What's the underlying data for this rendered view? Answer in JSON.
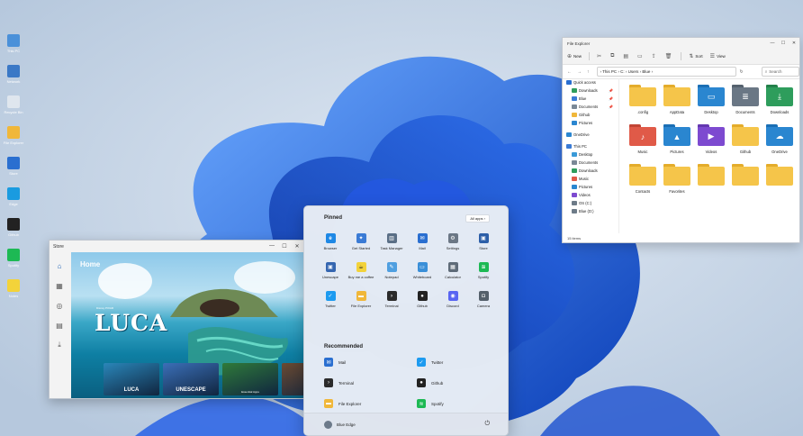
{
  "colors": {
    "accent": "#1b62d6",
    "folder": "#f5c54a",
    "folder_tab": "#e4ac2b"
  },
  "desktop": {
    "icons": [
      {
        "name": "this-pc-icon",
        "color": "#4a90d9",
        "label": "This PC"
      },
      {
        "name": "network-icon",
        "color": "#3a78c6",
        "label": "Network"
      },
      {
        "name": "recycle-bin-icon",
        "color": "#dfe6ee",
        "label": "Recycle Bin"
      },
      {
        "name": "file-explorer-icon",
        "color": "#f0b73a",
        "label": "File Explorer"
      },
      {
        "name": "store-icon",
        "color": "#2a6fd0",
        "label": "Store"
      },
      {
        "name": "edge-icon",
        "color": "#1a9be0",
        "label": "Edge"
      },
      {
        "name": "github-icon",
        "color": "#222222",
        "label": "Github"
      },
      {
        "name": "spotify-icon",
        "color": "#1db954",
        "label": "Spotify"
      },
      {
        "name": "notes-icon",
        "color": "#f3d33a",
        "label": "Notes"
      }
    ]
  },
  "store": {
    "title": "Store",
    "controls": [
      "—",
      "☐",
      "✕"
    ],
    "nav": [
      {
        "name": "home-icon",
        "glyph": "⌂",
        "active": true
      },
      {
        "name": "apps-icon",
        "glyph": "▦",
        "active": false
      },
      {
        "name": "gaming-icon",
        "glyph": "◎",
        "active": false
      },
      {
        "name": "movies-icon",
        "glyph": "▤",
        "active": false
      },
      {
        "name": "download-icon",
        "glyph": "⤓",
        "active": false
      }
    ],
    "hero": {
      "heading": "Home",
      "subtitle": "Disney PIXAR",
      "title": "LUCA"
    },
    "tiles": [
      {
        "label": "LUCA",
        "caption": "",
        "color": "#2a86b9"
      },
      {
        "label": "UNESCAPE",
        "caption": "",
        "color": "#3b6fb8"
      },
      {
        "label": "",
        "caption": "Essential Apps",
        "color": "#2f7a3a"
      },
      {
        "label": "",
        "caption": "",
        "color": "#6b4a32"
      }
    ]
  },
  "start": {
    "pinned_label": "Pinned",
    "all_apps_label": "All apps  ›",
    "pinned": [
      {
        "name": "Browser",
        "color": "#1e88e5",
        "glyph": "e"
      },
      {
        "name": "Get Started",
        "color": "#3a7bd5",
        "glyph": "✦"
      },
      {
        "name": "Task Manager",
        "color": "#5a6f86",
        "glyph": "▥"
      },
      {
        "name": "Mail",
        "color": "#2a6fd0",
        "glyph": "✉"
      },
      {
        "name": "Settings",
        "color": "#6b7785",
        "glyph": "⚙"
      },
      {
        "name": "Store",
        "color": "#2d5fa8",
        "glyph": "▣"
      },
      {
        "name": "Unescape",
        "color": "#3566b0",
        "glyph": "▣"
      },
      {
        "name": "Buy me a coffee",
        "color": "#f2d23a",
        "glyph": "☕"
      },
      {
        "name": "Notepad",
        "color": "#4f9fe0",
        "glyph": "✎"
      },
      {
        "name": "Whiteboard",
        "color": "#3a8fd8",
        "glyph": "▭"
      },
      {
        "name": "Calculator",
        "color": "#5e6b78",
        "glyph": "▦"
      },
      {
        "name": "Spotify",
        "color": "#1db954",
        "glyph": "≋"
      },
      {
        "name": "Twitter",
        "color": "#1d9bf0",
        "glyph": "✓"
      },
      {
        "name": "File Explorer",
        "color": "#f0b73a",
        "glyph": "▬"
      },
      {
        "name": "Terminal",
        "color": "#2b2b2b",
        "glyph": "›"
      },
      {
        "name": "Github",
        "color": "#222222",
        "glyph": "●"
      },
      {
        "name": "Discord",
        "color": "#5865f2",
        "glyph": "◉"
      },
      {
        "name": "Camera",
        "color": "#55606b",
        "glyph": "◘"
      }
    ],
    "recommended_label": "Recommended",
    "recommended": [
      {
        "name": "Mail",
        "color": "#2a6fd0",
        "glyph": "✉"
      },
      {
        "name": "Twitter",
        "color": "#1d9bf0",
        "glyph": "✓"
      },
      {
        "name": "Terminal",
        "color": "#2b2b2b",
        "glyph": "›"
      },
      {
        "name": "Github",
        "color": "#222222",
        "glyph": "●"
      },
      {
        "name": "File Explorer",
        "color": "#f0b73a",
        "glyph": "▬"
      },
      {
        "name": "Spotify",
        "color": "#1db954",
        "glyph": "≋"
      }
    ],
    "user": "Blue Edge",
    "power_glyph": "⏻"
  },
  "explorer": {
    "title": "File Explorer",
    "controls": [
      "—",
      "☐",
      "✕"
    ],
    "cmd": {
      "new": "New",
      "sort": "Sort",
      "view": "View"
    },
    "nav_glyphs": [
      "←",
      "→",
      "↑",
      "↻"
    ],
    "path": "› This PC  ›  C:  ›  Users  ›  Blue  ›",
    "search_placeholder": "Search",
    "tree": [
      {
        "label": "Quick access",
        "color": "#2a6fd0",
        "indent": 0,
        "pin": false
      },
      {
        "label": "Downloads",
        "color": "#2e9d5c",
        "indent": 1,
        "pin": true
      },
      {
        "label": "Blue",
        "color": "#3a7bd5",
        "indent": 1,
        "pin": true
      },
      {
        "label": "Documents",
        "color": "#7a8896",
        "indent": 1,
        "pin": true
      },
      {
        "label": "Github",
        "color": "#f0b73a",
        "indent": 1,
        "pin": false
      },
      {
        "label": "Pictures",
        "color": "#2a86d0",
        "indent": 1,
        "pin": false
      },
      {
        "label": "OneDrive",
        "color": "#2a86d0",
        "indent": 0,
        "pin": false
      },
      {
        "label": "This PC",
        "color": "#3a7bd5",
        "indent": 0,
        "pin": false
      },
      {
        "label": "Desktop",
        "color": "#3a9ad8",
        "indent": 1,
        "pin": false
      },
      {
        "label": "Documents",
        "color": "#7a8896",
        "indent": 1,
        "pin": false
      },
      {
        "label": "Downloads",
        "color": "#2e9d5c",
        "indent": 1,
        "pin": false
      },
      {
        "label": "Music",
        "color": "#e05a48",
        "indent": 1,
        "pin": false
      },
      {
        "label": "Pictures",
        "color": "#2a86d0",
        "indent": 1,
        "pin": false
      },
      {
        "label": "Videos",
        "color": "#7d4ad0",
        "indent": 1,
        "pin": false
      },
      {
        "label": "OS (C:)",
        "color": "#6d7b88",
        "indent": 1,
        "pin": false
      },
      {
        "label": "Blue (D:)",
        "color": "#6d7b88",
        "indent": 1,
        "pin": false
      }
    ],
    "items": [
      {
        "label": ".config",
        "color": "#f5c54a",
        "tab": "#e4ac2b",
        "glyph": ""
      },
      {
        "label": "AppData",
        "color": "#f5c54a",
        "tab": "#e4ac2b",
        "glyph": ""
      },
      {
        "label": "Desktop",
        "color": "#2a86d0",
        "tab": "#1b6fb5",
        "glyph": "▭"
      },
      {
        "label": "Documents",
        "color": "#6a7785",
        "tab": "#55616e",
        "glyph": "≣"
      },
      {
        "label": "Downloads",
        "color": "#2e9d5c",
        "tab": "#23804a",
        "glyph": "⤓"
      },
      {
        "label": "Music",
        "color": "#e05a48",
        "tab": "#c24535",
        "glyph": "♪"
      },
      {
        "label": "Pictures",
        "color": "#2a86d0",
        "tab": "#1b6fb5",
        "glyph": "▲"
      },
      {
        "label": "Videos",
        "color": "#7d4ad0",
        "tab": "#6438b0",
        "glyph": "▶"
      },
      {
        "label": "Github",
        "color": "#f5c54a",
        "tab": "#e4ac2b",
        "glyph": ""
      },
      {
        "label": "OneDrive",
        "color": "#2a86d0",
        "tab": "#1b6fb5",
        "glyph": "☁"
      },
      {
        "label": "Contacts",
        "color": "#f5c54a",
        "tab": "#e4ac2b",
        "glyph": ""
      },
      {
        "label": "Favorites",
        "color": "#f5c54a",
        "tab": "#e4ac2b",
        "glyph": ""
      },
      {
        "label": "",
        "color": "#f5c54a",
        "tab": "#e4ac2b",
        "glyph": ""
      },
      {
        "label": "",
        "color": "#f5c54a",
        "tab": "#e4ac2b",
        "glyph": ""
      },
      {
        "label": "",
        "color": "#f5c54a",
        "tab": "#e4ac2b",
        "glyph": ""
      }
    ],
    "status": "15 items"
  }
}
